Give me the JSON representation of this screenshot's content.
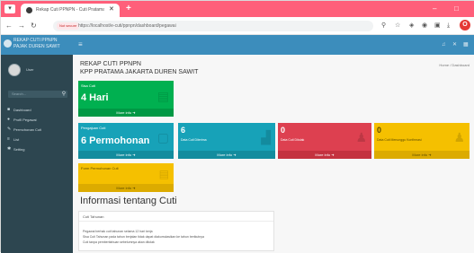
{
  "browser": {
    "tab_title": "Rekap Cuti PPNPN - Cuti Pratama Jakarta Duren Sawit",
    "url_badge": "Not secure",
    "url": "https://localhost/e-cuti/ppnpn/dashboard/pegawai",
    "icons": [
      "menu-icon",
      "back-icon",
      "forward-icon",
      "reload-icon",
      "star-icon",
      "extensions-icon",
      "profile-icon"
    ]
  },
  "sidebar": {
    "brand": "REKAP CUTI PPNPN PAJAK DUREN SAWIT",
    "user_name": "User",
    "search_placeholder": "Search...",
    "items": [
      {
        "label": "Dashboard",
        "icon": "dashboard-icon"
      },
      {
        "label": "Profil Pegawai",
        "icon": "user-icon"
      },
      {
        "label": "Permohonan Cuti",
        "icon": "edit-icon"
      },
      {
        "label": "List",
        "icon": "list-icon"
      },
      {
        "label": "Setting",
        "icon": "gear-icon"
      }
    ]
  },
  "header": {
    "title_line1": "REKAP CUTI PPNPN",
    "title_line2": "KPP PRATAMA JAKARTA DUREN SAWIT",
    "breadcrumb": "Home / Dashboard"
  },
  "boxes": [
    {
      "label": "Sisa Cuti",
      "value": "4 Hari",
      "footer": "More info",
      "color": "#00b050"
    },
    {
      "label": "Pengajuan Cuti",
      "value": "6 Permohonan",
      "footer": "More info",
      "color": "#17a2b8"
    },
    {
      "value": "6",
      "sub": "Data Cuti Diterima",
      "footer": "More info",
      "color": "#17a2b8"
    },
    {
      "value": "0",
      "sub": "Data Cuti Ditolak",
      "footer": "More info",
      "color": "#dd4050"
    },
    {
      "value": "0",
      "sub": "Data Cuti Menunggu Konfirmasi",
      "footer": "More info",
      "color": "#f5c000"
    },
    {
      "label": "Form Permohonan Cuti",
      "footer": "More info",
      "color": "#f5c000"
    }
  ],
  "info": {
    "title": "Informasi tentang Cuti",
    "card_header": "Cuti Tahunan",
    "lines": [
      "Pegawai berhak cuti tahunan selama 12 hari kerja",
      "Sisa Cuti Tahunan pada tahun berjalan tidak dapat diakumulasikan ke tahun berikutnya",
      "Cuti tanpa pemberitahuan sebelumnya akan ditolak"
    ]
  }
}
